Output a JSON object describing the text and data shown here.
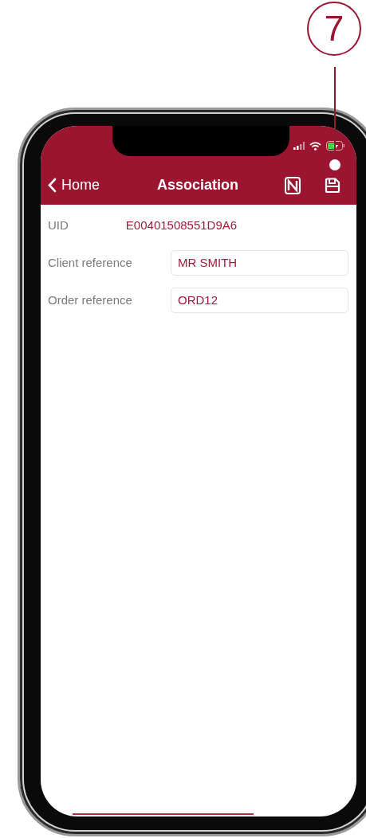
{
  "callout": {
    "number": "7"
  },
  "nav_bar": {
    "back_label": "Home",
    "title": "Association"
  },
  "form": {
    "rows": [
      {
        "kind": "text",
        "label": "UID",
        "value": "E00401508551D9A6"
      },
      {
        "kind": "field",
        "label": "Client reference",
        "value": "MR SMITH"
      },
      {
        "kind": "field",
        "label": "Order reference",
        "value": "ORD12"
      }
    ]
  }
}
